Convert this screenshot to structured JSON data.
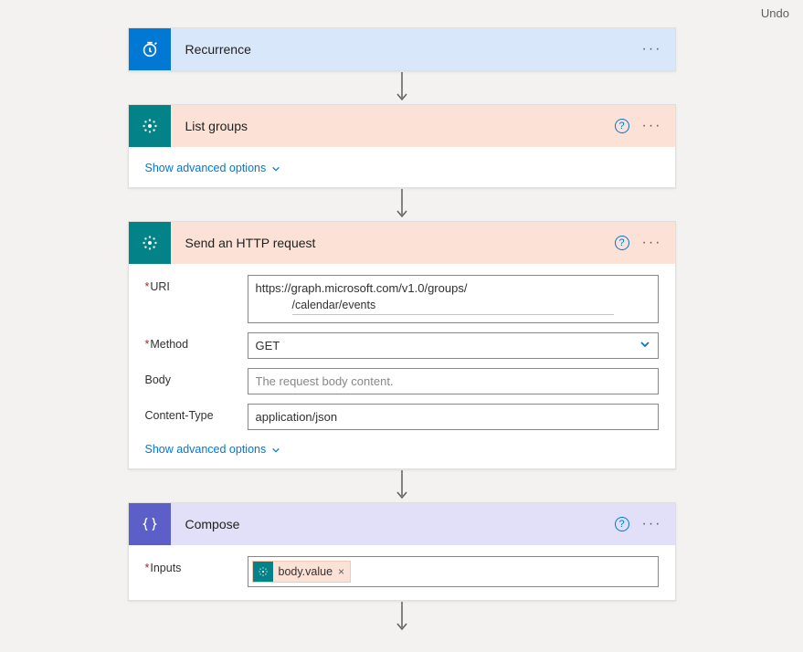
{
  "topbar": {
    "undo": "Undo"
  },
  "steps": {
    "recurrence": {
      "title": "Recurrence"
    },
    "listGroups": {
      "title": "List groups",
      "advanced": "Show advanced options"
    },
    "httpRequest": {
      "title": "Send an HTTP request",
      "advanced": "Show advanced options",
      "fields": {
        "uriLabel": "URI",
        "uriLine1": "https://graph.microsoft.com/v1.0/groups/",
        "uriLine2": "/calendar/events",
        "methodLabel": "Method",
        "methodValue": "GET",
        "bodyLabel": "Body",
        "bodyPlaceholder": "The request body content.",
        "contentTypeLabel": "Content-Type",
        "contentTypeValue": "application/json"
      }
    },
    "compose": {
      "title": "Compose",
      "fields": {
        "inputsLabel": "Inputs",
        "tokenText": "body.value"
      }
    }
  },
  "glyphs": {
    "help": "?",
    "more": "···",
    "remove": "×"
  }
}
